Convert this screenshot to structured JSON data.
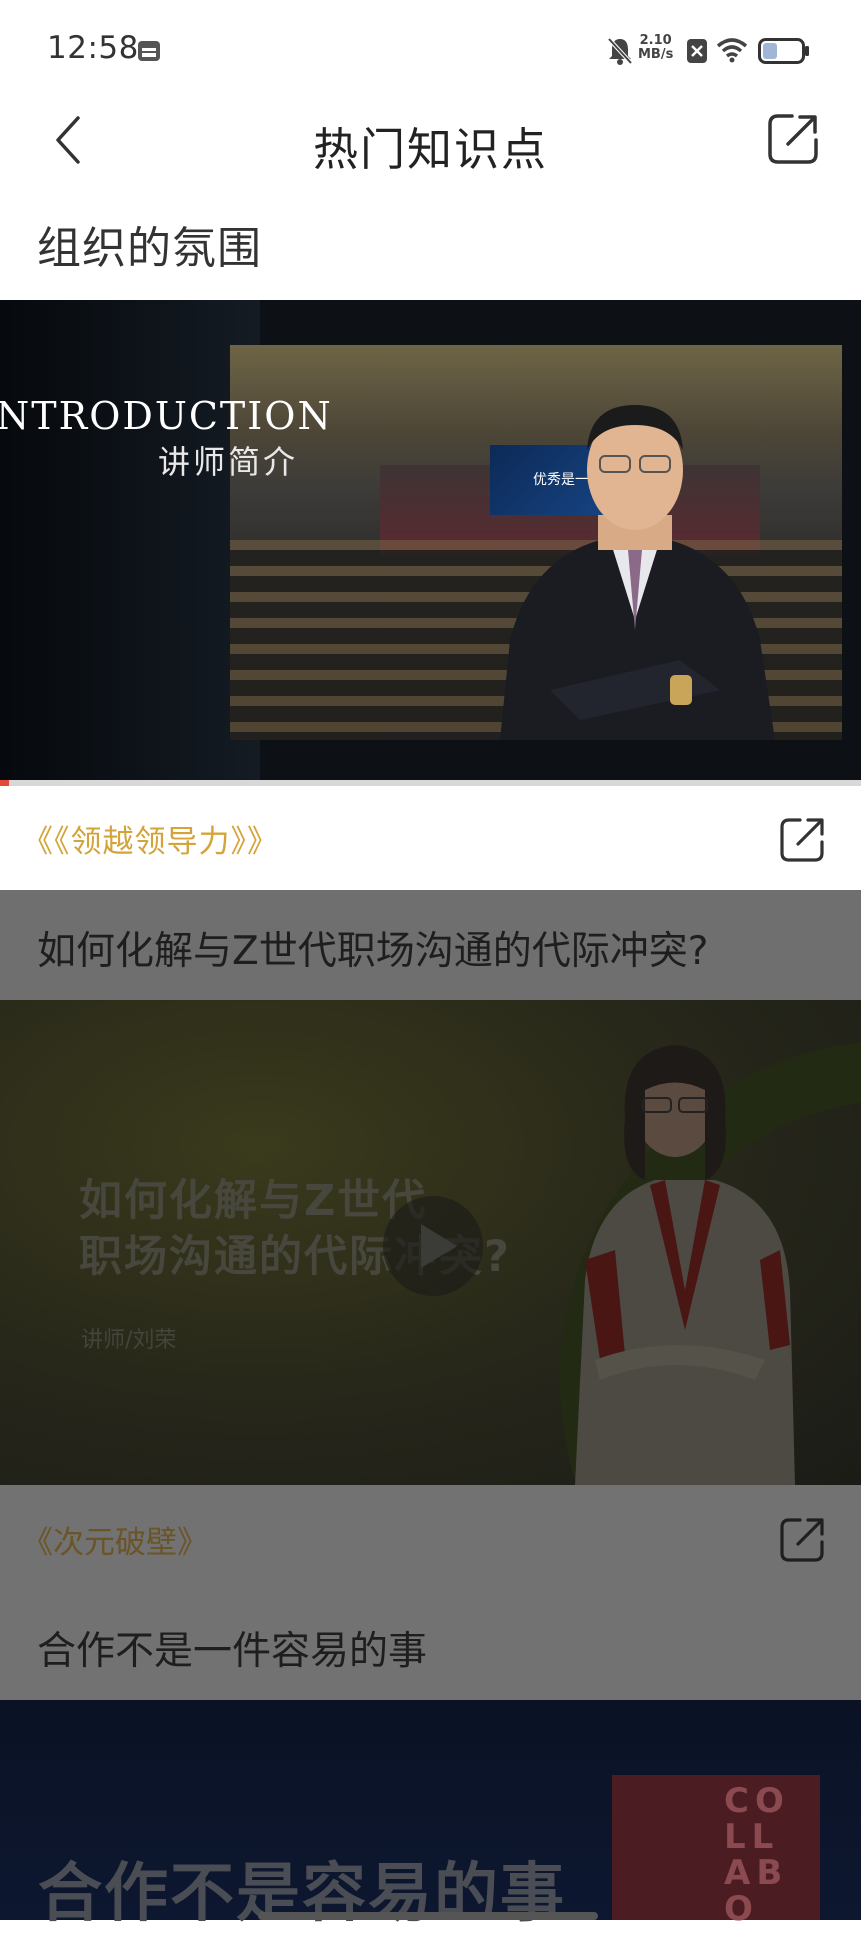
{
  "status_bar": {
    "time": "12:58",
    "net_speed_value": "2.10",
    "net_speed_unit": "MB/s"
  },
  "header": {
    "title": "热门知识点"
  },
  "section": {
    "title": "组织的氛围"
  },
  "card1": {
    "intro_en": "NTRODUCTION",
    "intro_cn": "讲师简介",
    "screen_text": "优秀是一种习",
    "course": "《《领越领导力》》",
    "progress": 0.01
  },
  "card2": {
    "question": "如何化解与Z世代职场沟通的代际冲突?",
    "video_title_line1": "如何化解与Z世代",
    "video_title_line2": "职场沟通的代际冲突?",
    "lecturer": "讲师/刘荣",
    "course": "《次元破壁》"
  },
  "card3": {
    "question": "合作不是一件容易的事",
    "video_title": "合作不是容易的事",
    "book_text": "COLLABO"
  },
  "colors": {
    "accent_gold": "#d4a43a",
    "progress_red": "#e24b3b",
    "dim_overlay": "#6f6f6f"
  },
  "icons": {
    "back": "chevron-left-icon",
    "share": "share-icon",
    "play": "play-icon"
  }
}
